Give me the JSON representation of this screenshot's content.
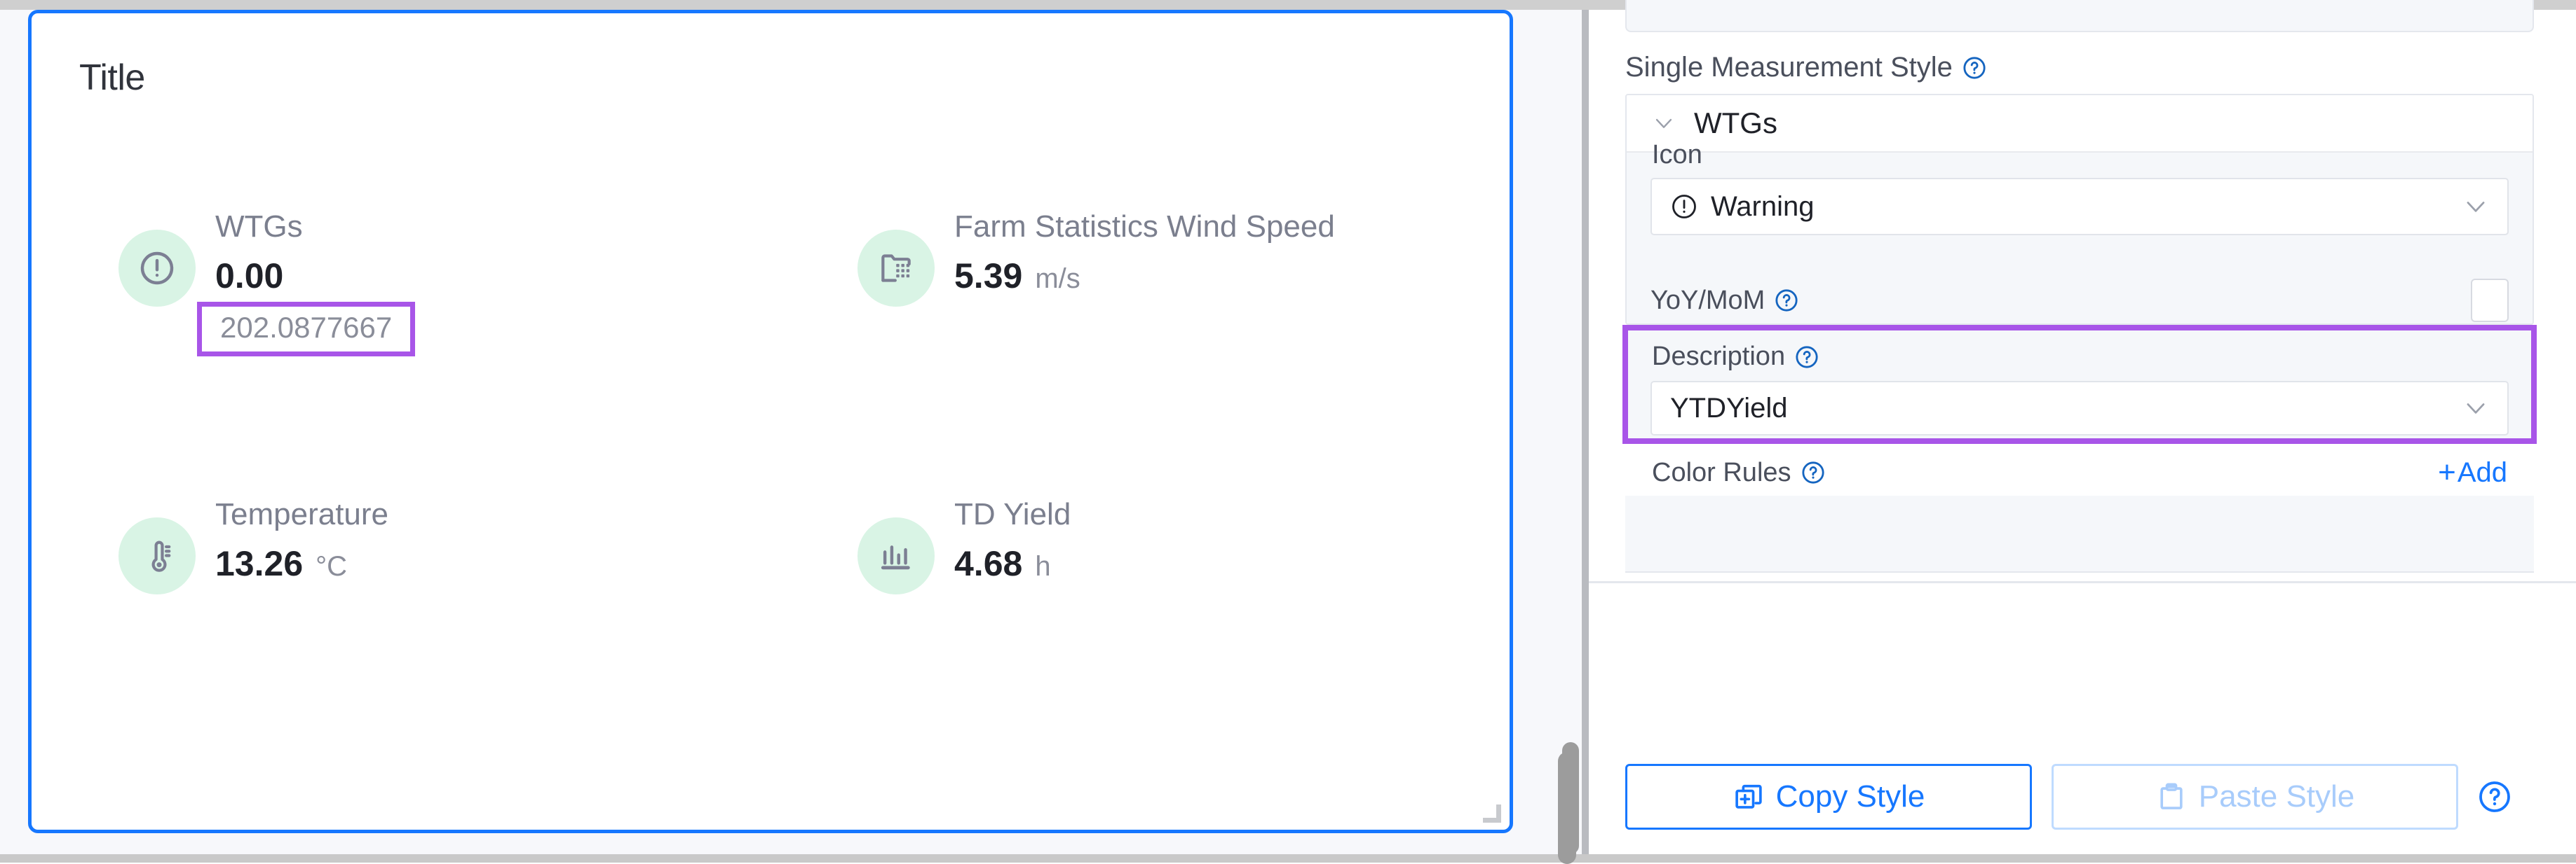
{
  "widget": {
    "title": "Title",
    "metrics": [
      {
        "icon": "warning-circle-icon",
        "label": "WTGs",
        "value": "0.00",
        "unit": "",
        "sub": "202.0877667",
        "sub_highlighted": true
      },
      {
        "icon": "statistics-folder-icon",
        "label": "Farm Statistics Wind Speed",
        "value": "5.39",
        "unit": "m/s",
        "sub": "",
        "sub_highlighted": false
      },
      {
        "icon": "thermometer-icon",
        "label": "Temperature",
        "value": "13.26",
        "unit": "°C",
        "sub": "",
        "sub_highlighted": false
      },
      {
        "icon": "bar-chart-icon",
        "label": "TD Yield",
        "value": "4.68",
        "unit": "h",
        "sub": "",
        "sub_highlighted": false
      }
    ]
  },
  "settings": {
    "section_label": "Single Measurement Style",
    "collapse": {
      "title": "WTGs",
      "expanded": true
    },
    "icon_field": {
      "label": "Icon",
      "value": "Warning",
      "leading_icon": "warning-circle-icon"
    },
    "yoy_field": {
      "label": "YoY/MoM",
      "checked": false
    },
    "description_field": {
      "label": "Description",
      "value": "YTDYield",
      "highlighted": true
    },
    "color_rules": {
      "label": "Color Rules",
      "add_label": "Add",
      "add_plus": "+"
    },
    "footer": {
      "copy_label": "Copy Style",
      "paste_label": "Paste Style",
      "paste_disabled": true
    }
  },
  "colors": {
    "accent_blue": "#1677ff",
    "highlight_purple": "#a855e8",
    "icon_bubble_green": "#d9f4e5",
    "icon_glyph_grey": "#7c7f93",
    "panel_grey": "#f5f7fa",
    "muted_text": "#8a8d99"
  }
}
